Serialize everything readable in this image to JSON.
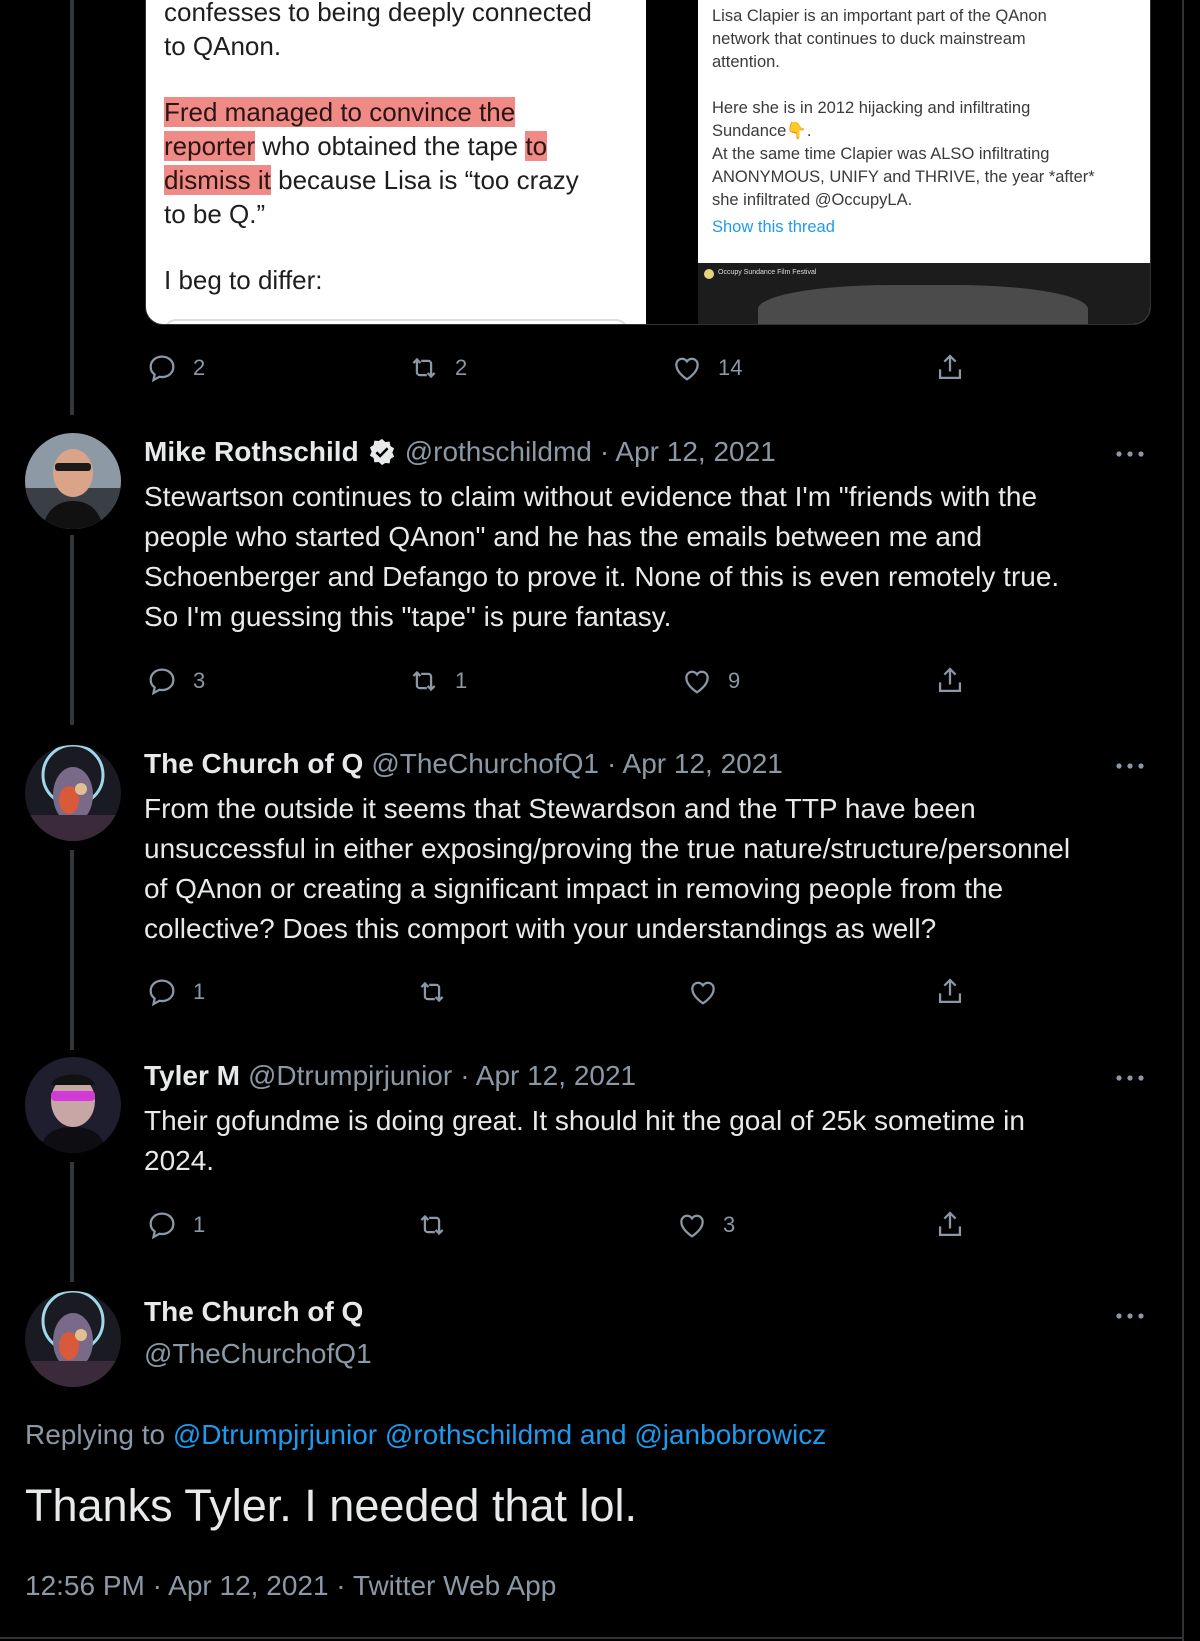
{
  "quoted_media": {
    "left_doc": {
      "lines": [
        {
          "pre": "confesses to being deeply connected",
          "hl": "",
          "post": ""
        },
        {
          "pre": "to QAnon.",
          "hl": "",
          "post": ""
        },
        {
          "pre": "",
          "hl": "Fred managed to convince the",
          "post": ""
        },
        {
          "pre": "",
          "hl": "reporter",
          "post": " who obtained the tape ",
          "hl2": "to"
        },
        {
          "pre": "",
          "hl": "dismiss it",
          "post": " because Lisa is “too crazy"
        },
        {
          "pre": "to be Q.”",
          "hl": "",
          "post": ""
        },
        {
          "pre": "I beg to differ:",
          "hl": "",
          "post": ""
        }
      ]
    },
    "right_shot": {
      "lines": [
        "Lisa Clapier is an important part of the QAnon",
        "network that continues to duck mainstream",
        "attention.",
        "Here she is in 2012 hijacking and infiltrating",
        "Sundance👇.",
        "At the same time Clapier was ALSO infiltrating",
        "ANONYMOUS, UNIFY and THRIVE, the year *after*",
        "she infiltrated @OccupyLA."
      ],
      "show_thread": "Show this thread",
      "video_title": "Occupy Sundance Film Festival"
    }
  },
  "tweets": [
    {
      "id": "quote",
      "actions": {
        "reply": "2",
        "retweet": "2",
        "like": "14"
      }
    },
    {
      "id": "mike",
      "name": "Mike Rothschild",
      "handle": "@rothschildmd",
      "date": "· Apr 12, 2021",
      "verified": true,
      "lines": [
        "Stewartson continues to claim without evidence that I'm \"friends with the",
        "people who started QAnon\" and he has the emails between me and",
        "Schoenberger and Defango to prove it. None of this is even remotely true.",
        "So I'm guessing this \"tape\" is pure fantasy."
      ],
      "actions": {
        "reply": "3",
        "retweet": "1",
        "like": "9"
      }
    },
    {
      "id": "church1",
      "name": "The Church of Q",
      "handle": "@TheChurchofQ1",
      "date": "· Apr 12, 2021",
      "lines": [
        "From the outside it seems that Stewardson and the TTP have been",
        "unsuccessful in either exposing/proving the true nature/structure/personnel",
        "of QAnon or creating a significant impact in removing people from the",
        "collective? Does this comport with your understandings as well?"
      ],
      "actions": {
        "reply": "1",
        "retweet": "",
        "like": ""
      }
    },
    {
      "id": "tyler",
      "name": "Tyler M",
      "handle": "@Dtrumpjrjunior",
      "date": "· Apr 12, 2021",
      "lines": [
        "Their gofundme is doing great. It should hit the goal of 25k sometime in",
        "2024."
      ],
      "actions": {
        "reply": "1",
        "retweet": "",
        "like": "3"
      }
    }
  ],
  "main_tweet": {
    "name": "The Church of Q",
    "handle": "@TheChurchofQ1",
    "replying_prefix": "Replying to ",
    "reply_1": "@Dtrumpjrjunior",
    "reply_2": "@rothschildmd",
    "reply_and": " and ",
    "reply_3": "@janbobrowicz",
    "text": "Thanks Tyler. I needed that lol.",
    "meta": "12:56 PM · Apr 12, 2021 · Twitter Web App"
  },
  "icons": [
    "reply-icon",
    "retweet-icon",
    "like-icon",
    "share-icon",
    "more-icon",
    "verified-icon"
  ],
  "colors": {
    "background": "#000000",
    "text": "#e7e9ea",
    "secondary": "#8b98a5",
    "link": "#1d9bf0",
    "highlight": "#f08a87"
  }
}
